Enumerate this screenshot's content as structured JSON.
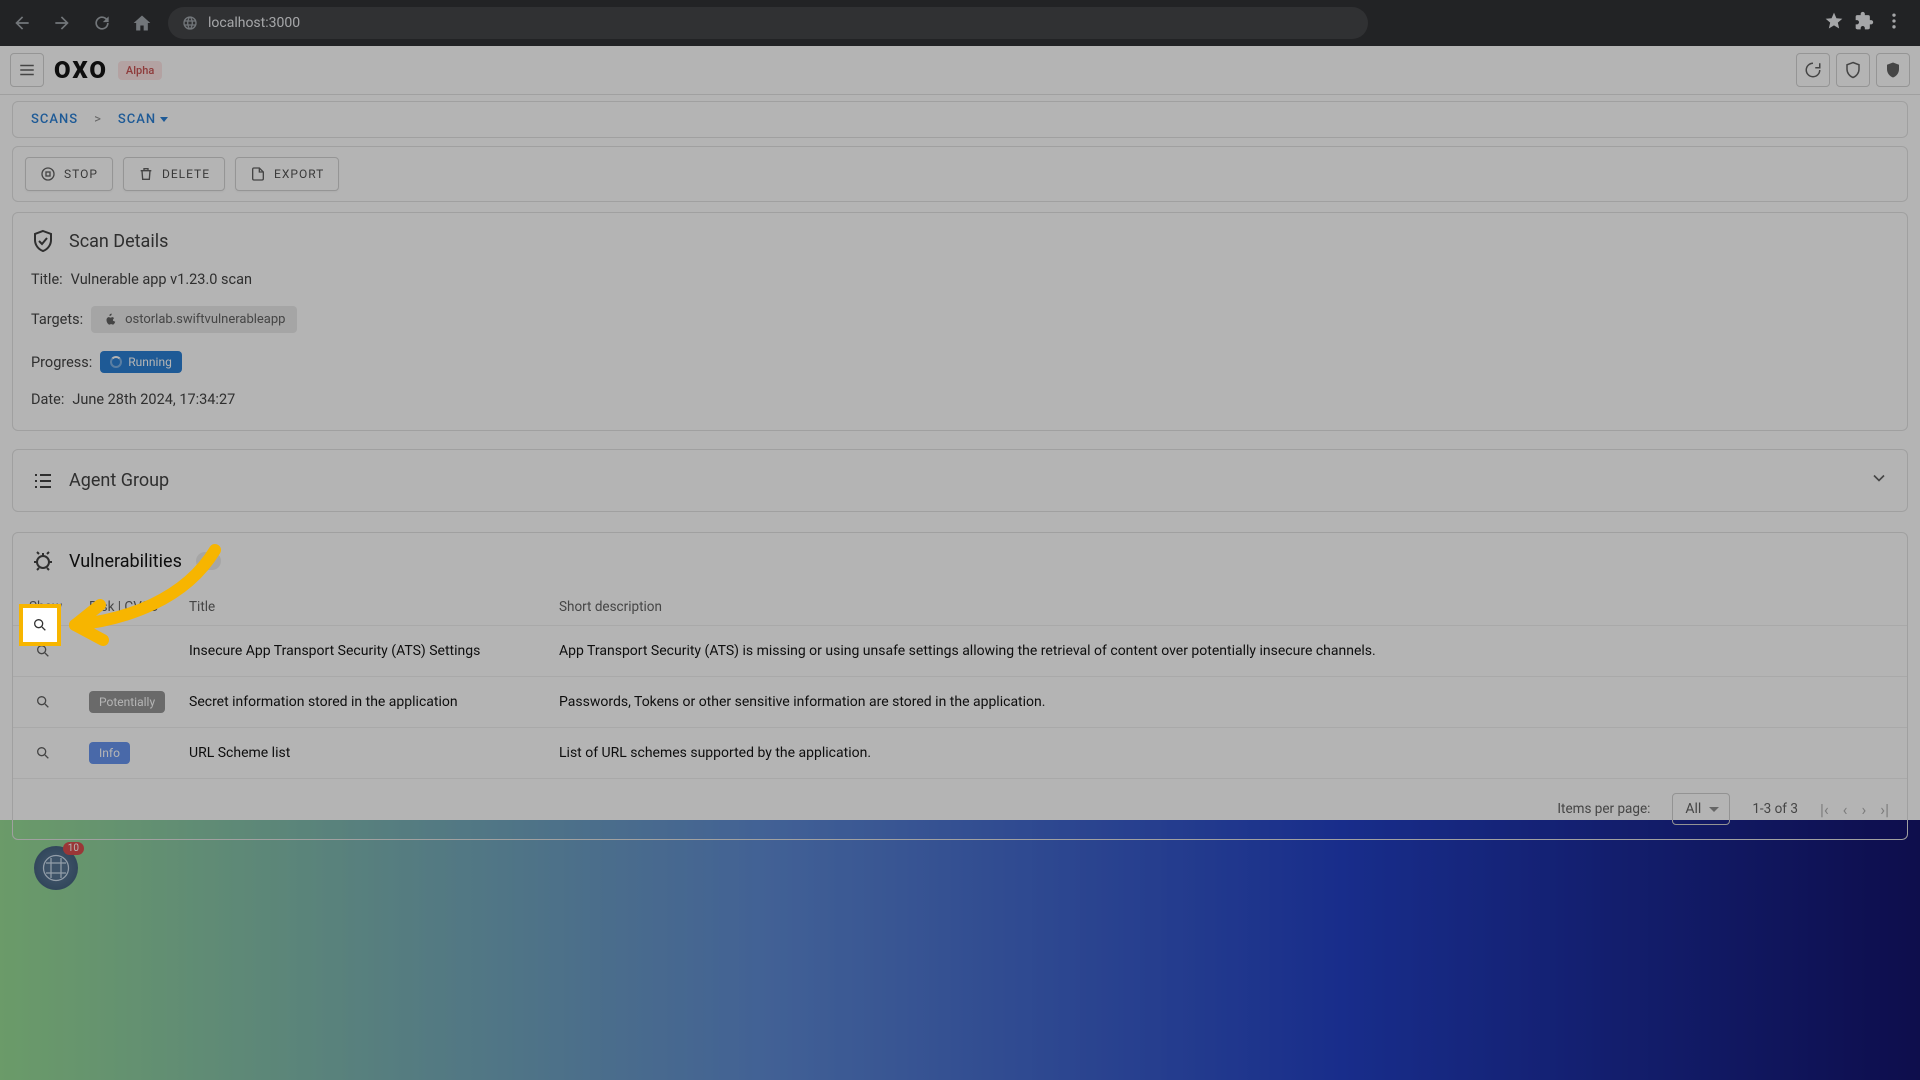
{
  "browser": {
    "url": "localhost:3000"
  },
  "app": {
    "logo": "OXO",
    "badge": "Alpha"
  },
  "breadcrumb": {
    "root": "SCANS",
    "sep": ">",
    "current": "SCAN"
  },
  "actions": {
    "stop": "STOP",
    "delete": "DELETE",
    "export": "EXPORT"
  },
  "details": {
    "heading": "Scan Details",
    "title_label": "Title:",
    "title_value": "Vulnerable app v1.23.0 scan",
    "targets_label": "Targets:",
    "target_value": "ostorlab.swiftvulnerableapp",
    "progress_label": "Progress:",
    "progress_value": "Running",
    "date_label": "Date:",
    "date_value": "June 28th 2024, 17:34:27"
  },
  "agent_group": {
    "heading": "Agent Group"
  },
  "vulns": {
    "heading": "Vulnerabilities",
    "count": "3",
    "cols": {
      "show": "Show",
      "risk": "Risk | CVSS",
      "title": "Title",
      "desc": "Short description"
    },
    "rows": [
      {
        "risk": "",
        "risk_class": "row-hidden-risk",
        "title": "Insecure App Transport Security (ATS) Settings",
        "desc": "App Transport Security (ATS) is missing or using unsafe settings allowing the retrieval of content over potentially insecure channels."
      },
      {
        "risk": "Potentially",
        "risk_class": "risk-potentially",
        "title": "Secret information stored in the application",
        "desc": "Passwords, Tokens or other sensitive information are stored in the application."
      },
      {
        "risk": "Info",
        "risk_class": "risk-info",
        "title": "URL Scheme list",
        "desc": "List of URL schemes supported by the application."
      }
    ]
  },
  "pagination": {
    "items_label": "Items per page:",
    "per_page": "All",
    "range": "1-3 of 3"
  },
  "floating": {
    "count": "10"
  }
}
